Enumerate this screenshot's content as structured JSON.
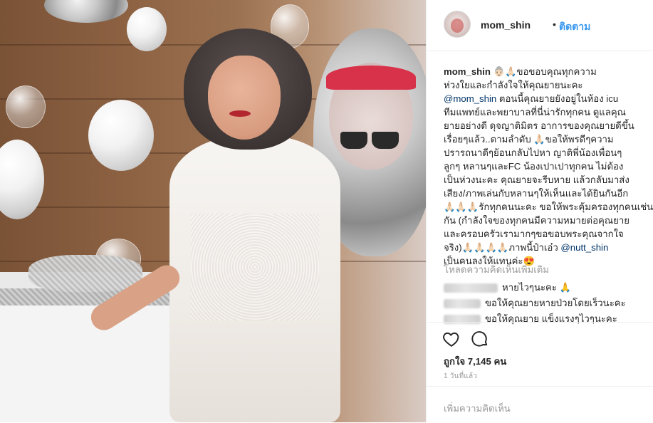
{
  "post": {
    "username": "mom_shin",
    "separator": "•",
    "follow_label": "ติดตาม"
  },
  "caption": {
    "username": "mom_shin",
    "lines": [
      "👵🏻🙏🏻ขอขอบคุณทุกความ",
      "ห่วงใยและกำลังใจให้คุณยายนะคะ",
      "@mom_shin ตอนนี้คุณยายยังอยู่ในห้อง icu",
      "ทีมแพทย์และพยาบาลที่นี่น่ารักทุกคน ดูแลคุณ",
      "ยายอย่างดี ดุจญาติมิตร อาการของคุณยายดีขึ้น",
      "เรื่อยๆแล้ว..ตามลำดับ 🙏🏻ขอให้พรดีๆความ",
      "ปรารถนาดีๆย้อนกลับไปหา ญาติพี่น้องเพื่อนๆ",
      "ลูกๆ หลานๆและFC น้องเปาเปาทุกคน ไม่ต้อง",
      "เป็นห่วงนะคะ คุณยายจะรีบหาย แล้วกลับมาส่ง",
      "เสียง/ภาพเล่นกับหลานๆให้เห็นและได้ยินกันอีก",
      "🙏🏻🙏🏻🙏🏻รักทุกคนนะคะ ขอให้พระคุ้มครองทุกคนเช่น",
      "กัน (กำลังใจของทุกคนมีความหมายต่อคุณยาย",
      "และครอบครัวเรามากๆขอขอบพระคุณจากใจ",
      "จริง)🙏🏻🙏🏻🙏🏻🙏🏻ภาพนี้ป๋าเอ๋ว @nutt_shin",
      "เป็นคนลงให้แทนค่ะ😍"
    ]
  },
  "comments": {
    "load_more": "โหลดความคิดเห็นเพิ่มเติม",
    "items": [
      {
        "text": "หายไวๆนะคะ 🙏"
      },
      {
        "text": "ขอให้คุณยายหายป่วยโดยเร็วนะคะ"
      },
      {
        "text": "ขอให้คุณยาย แข็งแรงๆไวๆนะคะ"
      }
    ]
  },
  "likes": {
    "text": "ถูกใจ 7,145 คน"
  },
  "time": {
    "text": "1 วันที่แล้ว"
  },
  "add_comment": {
    "placeholder": "เพิ่มความคิดเห็น"
  },
  "icons": {
    "like": "heart-icon",
    "comment": "speech-bubble-icon"
  }
}
